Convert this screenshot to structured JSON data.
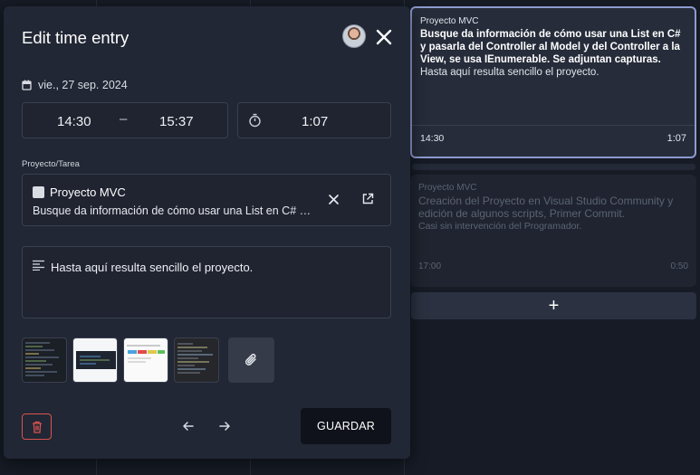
{
  "modal": {
    "title": "Edit time entry",
    "date": "vie., 27 sep. 2024",
    "time_start": "14:30",
    "time_separator": "–",
    "time_end": "15:37",
    "duration": "1:07",
    "project_label": "Proyecto/Tarea",
    "project_name": "Proyecto MVC",
    "project_description": "Busque da información de cómo usar una List en C# y pasarla del Controller al Model y del Controller a la View, se usa IEnumerable. Se adjuntan capturas.",
    "note": "Hasta aquí resulta sencillo el proyecto.",
    "attachments_count": 4,
    "save_label": "GUARDAR",
    "colors": {
      "delete": "#d9534f",
      "save_bg": "#0f121a",
      "panel": "#212734"
    }
  },
  "entries": [
    {
      "project": "Proyecto MVC",
      "description": "Busque da información de cómo usar una List en C# y pasarla del Controller al Model y del Controller a la View, se usa IEnumerable. Se adjuntan capturas.",
      "note": "Hasta aquí resulta sencillo el proyecto.",
      "start": "14:30",
      "duration": "1:07",
      "selected": true
    },
    {
      "project": "Proyecto MVC",
      "description": "Creación del Proyecto en Visual Studio Community y edición de algunos scripts, Primer Commit.",
      "note": "Casi sin intervención del Programador.",
      "start": "17:00",
      "duration": "0:50",
      "selected": false
    }
  ],
  "add_entry_label": "+",
  "icons": {
    "avatar": "user-avatar",
    "close": "close-icon",
    "calendar": "calendar-icon",
    "timer": "stopwatch-icon",
    "clear": "clear-icon",
    "open": "external-link-icon",
    "note": "align-left-icon",
    "attach": "paperclip-icon",
    "delete": "trash-icon",
    "prev": "arrow-left-icon",
    "next": "arrow-right-icon"
  }
}
